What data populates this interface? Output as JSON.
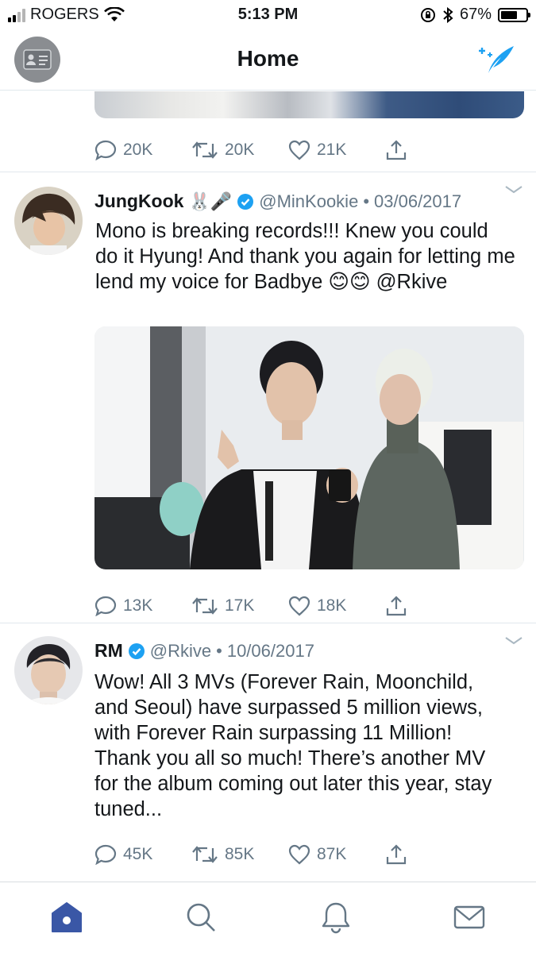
{
  "status_bar": {
    "carrier": "ROGERS",
    "time": "5:13 PM",
    "battery_percent": "67%",
    "battery_level": 0.67,
    "signal_bars_filled": 2,
    "signal_bars_total": 4
  },
  "header": {
    "title": "Home"
  },
  "colors": {
    "accent": "#1da1f2",
    "text": "#14171a",
    "muted": "#657786",
    "divider": "#e1e8ed",
    "tab_active": "#3a57a6"
  },
  "top_tweet_partial": {
    "replies": "20K",
    "retweets": "20K",
    "likes": "21K"
  },
  "tweets": [
    {
      "name": "JungKook",
      "name_emoji": "🐰🎤",
      "handle": "@MinKookie",
      "separator": "•",
      "date": "03/06/2017",
      "text": "Mono is breaking records!!! Knew you could do it Hyung! And thank you again for letting me lend my voice for Badbye 😊😊 @Rkive",
      "replies": "13K",
      "retweets": "17K",
      "likes": "18K",
      "has_photo": true
    },
    {
      "name": "RM",
      "handle": "@Rkive",
      "separator": "•",
      "date": "10/06/2017",
      "text": "Wow! All 3 MVs (Forever Rain, Moonchild, and Seoul) have surpassed 5 million views, with Forever Rain surpassing 11 Million! Thank you all so much! There’s another MV for the album coming out later this year, stay tuned...",
      "replies": "45K",
      "retweets": "85K",
      "likes": "87K",
      "has_photo": false
    }
  ],
  "tab_bar": {
    "active": "home",
    "tabs": [
      "home",
      "search",
      "notifications",
      "messages"
    ]
  },
  "icons": {
    "reply": "reply-icon",
    "retweet": "retweet-icon",
    "like": "heart-icon",
    "share": "share-icon",
    "verified": "verified-badge-icon",
    "compose": "compose-tweet-icon",
    "profile": "profile-card-icon"
  }
}
